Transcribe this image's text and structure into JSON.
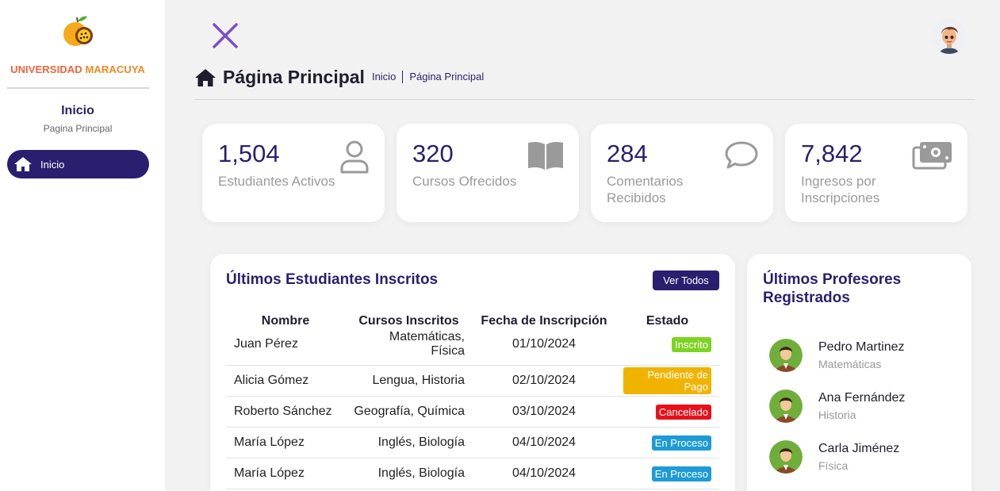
{
  "sidebar": {
    "brand_part1": "UNIVERSIDAD ",
    "brand_part2": "MARACUYA",
    "title": "Inicio",
    "subtitle": "Pagina Principal",
    "nav": [
      {
        "label": "Inicio",
        "icon": "home-icon"
      }
    ]
  },
  "header": {
    "title": "Página Principal",
    "breadcrumb": [
      "Inicio",
      "Página Principal"
    ]
  },
  "stats": [
    {
      "value": "1,504",
      "label": "Estudiantes Activos",
      "icon": "user-icon"
    },
    {
      "value": "320",
      "label": "Cursos Ofrecidos",
      "icon": "book-icon"
    },
    {
      "value": "284",
      "label": "Comentarios Recibidos",
      "icon": "comment-icon"
    },
    {
      "value": "7,842",
      "label": "Ingresos por Inscripciones",
      "icon": "money-icon"
    }
  ],
  "students": {
    "title": "Últimos Estudiantes Inscritos",
    "button": "Ver Todos",
    "columns": [
      "Nombre",
      "Cursos Inscritos",
      "Fecha de Inscripción",
      "Estado"
    ],
    "rows": [
      {
        "name": "Juan Pérez",
        "courses": "Matemáticas, Física",
        "date": "01/10/2024",
        "status": "Inscrito"
      },
      {
        "name": "Alicia Gómez",
        "courses": "Lengua, Historia",
        "date": "02/10/2024",
        "status": "Pendiente de Pago"
      },
      {
        "name": "Roberto Sánchez",
        "courses": "Geografía, Química",
        "date": "03/10/2024",
        "status": "Cancelado"
      },
      {
        "name": "María López",
        "courses": "Inglés, Biología",
        "date": "04/10/2024",
        "status": "En Proceso"
      },
      {
        "name": "María López",
        "courses": "Inglés, Biología",
        "date": "04/10/2024",
        "status": "En Proceso"
      }
    ]
  },
  "teachers": {
    "title": "Últimos Profesores Registrados",
    "list": [
      {
        "name": "Pedro Martinez",
        "subject": "Matemáticas"
      },
      {
        "name": "Ana Fernández",
        "subject": "Historia"
      },
      {
        "name": "Carla Jiménez",
        "subject": "Física"
      }
    ]
  },
  "colors": {
    "primary": "#2a1f6e",
    "inscrito": "#7ed321",
    "pendiente": "#f0b400",
    "cancelado": "#e8101a",
    "proceso": "#1e9bd7"
  }
}
